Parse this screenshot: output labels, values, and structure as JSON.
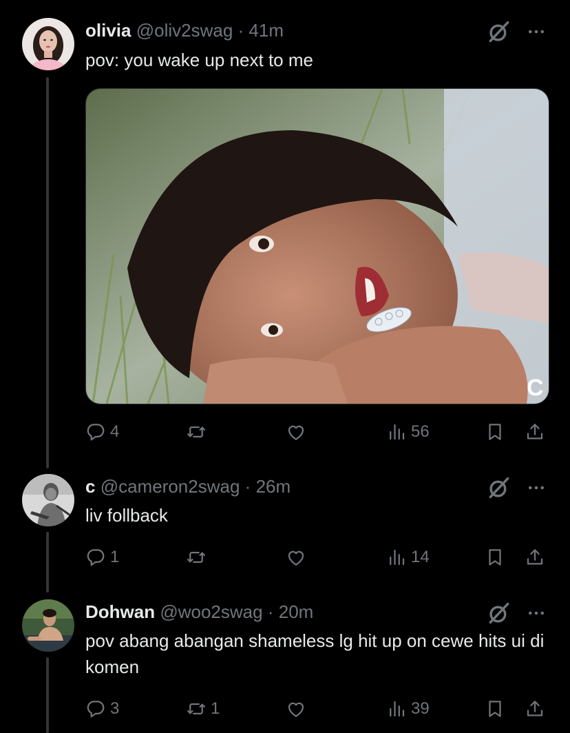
{
  "posts": [
    {
      "name": "olivia",
      "handle": "@oliv2swag",
      "dot": "·",
      "time": "41m",
      "text": "pov: you wake up next to me",
      "media": {
        "watermark": "C"
      },
      "actions": {
        "replies": "4",
        "reposts": "",
        "likes": "",
        "views": "56"
      }
    },
    {
      "name": "c",
      "handle": "@cameron2swag",
      "dot": "·",
      "time": "26m",
      "text": "liv follback",
      "actions": {
        "replies": "1",
        "reposts": "",
        "likes": "",
        "views": "14"
      }
    },
    {
      "name": "Dohwan",
      "handle": "@woo2swag",
      "dot": "·",
      "time": "20m",
      "text": "pov abang abangan shameless lg hit up on cewe hits ui di komen",
      "actions": {
        "replies": "3",
        "reposts": "1",
        "likes": "",
        "views": "39"
      }
    }
  ],
  "icons": {
    "reply": "reply-icon",
    "repost": "repost-icon",
    "like": "heart-icon",
    "views": "views-icon",
    "bookmark": "bookmark-icon",
    "share": "share-icon",
    "grok": "grok-icon",
    "more": "more-icon"
  },
  "colors": {
    "background": "#000000",
    "primary_text": "#e7e9ea",
    "secondary_text": "#71767b",
    "thread_line": "#333639"
  }
}
